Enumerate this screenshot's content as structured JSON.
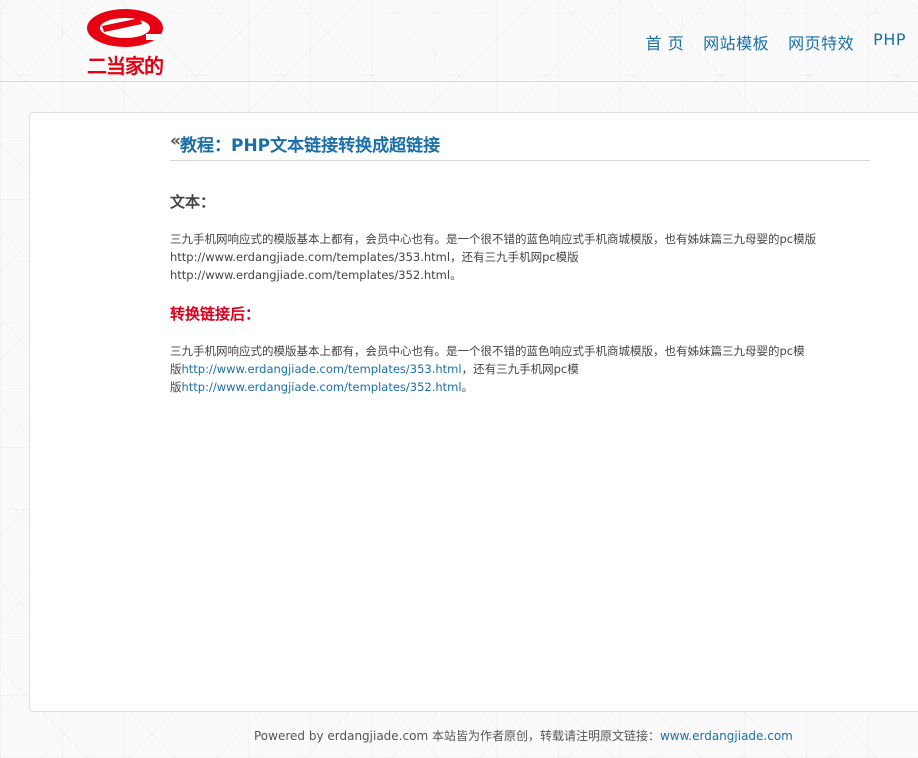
{
  "logo": {
    "text": "二当家的",
    "brand_color": "#e60012"
  },
  "nav": {
    "items": [
      {
        "label": "首 页"
      },
      {
        "label": "网站模板"
      },
      {
        "label": "网页特效"
      },
      {
        "label": "PHP"
      }
    ],
    "color": "#1a6fa8"
  },
  "article": {
    "back_icon": "«",
    "title": "教程：PHP文本链接转换成超链接",
    "text_heading": "文本：",
    "text_body_line1": "三九手机网响应式的模版基本上都有，会员中心也有。是一个很不错的蓝色响应式手机商城模版，也有姊妹篇三九母婴的pc模版",
    "text_body_line2": "http://www.erdangjiade.com/templates/353.html，还有三九手机网pc模版",
    "text_body_line3": "http://www.erdangjiade.com/templates/352.html。",
    "converted_heading": "转换链接后：",
    "converted_line1": "三九手机网响应式的模版基本上都有，会员中心也有。是一个很不错的蓝色响应式手机商城模版，也有姊妹篇三九母婴的pc模",
    "converted_prefix1": "版",
    "converted_link1": "http://www.erdangjiade.com/templates/353.html",
    "converted_middle": "，还有三九手机网pc模",
    "converted_prefix2": "版",
    "converted_link2": "http://www.erdangjiade.com/templates/352.html",
    "converted_suffix": "。",
    "heading_red": "#d9001b"
  },
  "footer": {
    "text": "Powered by erdangjiade.com 本站皆为作者原创，转载请注明原文链接：",
    "link": "www.erdangjiade.com"
  }
}
